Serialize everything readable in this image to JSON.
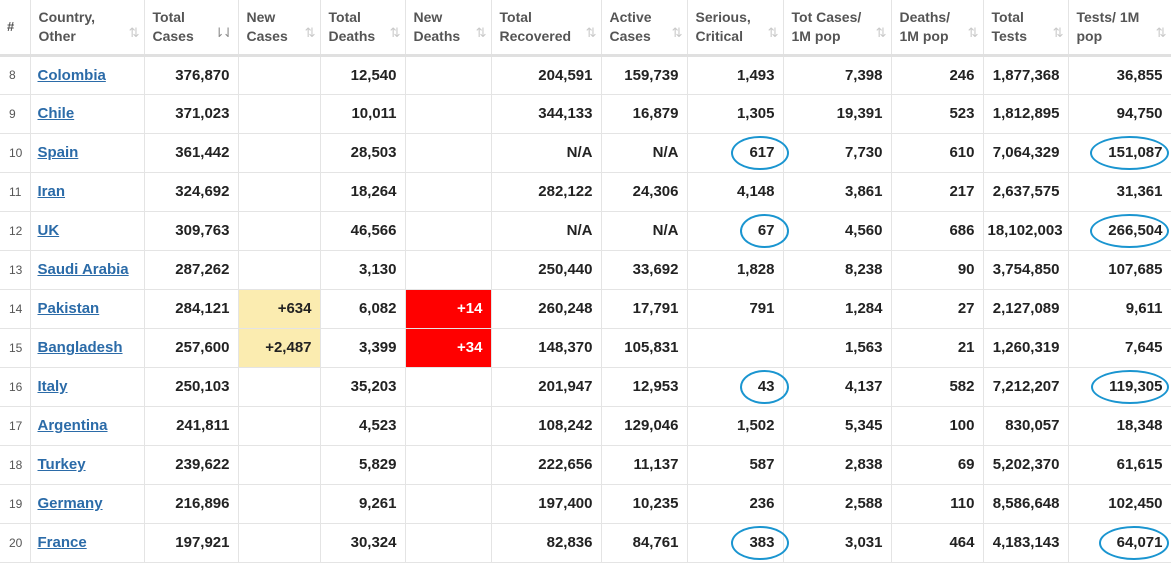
{
  "columns": [
    {
      "label": "#",
      "sortable": false
    },
    {
      "label": "Country, Other",
      "sortable": true
    },
    {
      "label": "Total Cases",
      "sortable": true,
      "active": true
    },
    {
      "label": "New Cases",
      "sortable": true
    },
    {
      "label": "Total Deaths",
      "sortable": true
    },
    {
      "label": "New Deaths",
      "sortable": true
    },
    {
      "label": "Total Recovered",
      "sortable": true
    },
    {
      "label": "Active Cases",
      "sortable": true
    },
    {
      "label": "Serious, Critical",
      "sortable": true
    },
    {
      "label": "Tot Cases/ 1M pop",
      "sortable": true
    },
    {
      "label": "Deaths/ 1M pop",
      "sortable": true
    },
    {
      "label": "Total Tests",
      "sortable": true
    },
    {
      "label": "Tests/ 1M pop",
      "sortable": true
    }
  ],
  "sort_icons": {
    "inactive": "⇅",
    "active": "⇂⇃"
  },
  "colors": {
    "new_cases_bg": "#fbecb0",
    "new_deaths_bg": "#ff0000",
    "link": "#2b6ba8",
    "circle_annotation": "#1a95d0"
  },
  "rows": [
    {
      "rank": "8",
      "country": "Colombia",
      "total_cases": "376,870",
      "new_cases": "",
      "total_deaths": "12,540",
      "new_deaths": "",
      "total_recovered": "204,591",
      "active_cases": "159,739",
      "serious": "1,493",
      "cases_per_m": "7,398",
      "deaths_per_m": "246",
      "total_tests": "1,877,368",
      "tests_per_m": "36,855"
    },
    {
      "rank": "9",
      "country": "Chile",
      "total_cases": "371,023",
      "new_cases": "",
      "total_deaths": "10,011",
      "new_deaths": "",
      "total_recovered": "344,133",
      "active_cases": "16,879",
      "serious": "1,305",
      "cases_per_m": "19,391",
      "deaths_per_m": "523",
      "total_tests": "1,812,895",
      "tests_per_m": "94,750"
    },
    {
      "rank": "10",
      "country": "Spain",
      "total_cases": "361,442",
      "new_cases": "",
      "total_deaths": "28,503",
      "new_deaths": "",
      "total_recovered": "N/A",
      "active_cases": "N/A",
      "serious": "617",
      "cases_per_m": "7,730",
      "deaths_per_m": "610",
      "total_tests": "7,064,329",
      "tests_per_m": "151,087",
      "circled": [
        "serious",
        "tests_per_m"
      ]
    },
    {
      "rank": "11",
      "country": "Iran",
      "total_cases": "324,692",
      "new_cases": "",
      "total_deaths": "18,264",
      "new_deaths": "",
      "total_recovered": "282,122",
      "active_cases": "24,306",
      "serious": "4,148",
      "cases_per_m": "3,861",
      "deaths_per_m": "217",
      "total_tests": "2,637,575",
      "tests_per_m": "31,361"
    },
    {
      "rank": "12",
      "country": "UK",
      "total_cases": "309,763",
      "new_cases": "",
      "total_deaths": "46,566",
      "new_deaths": "",
      "total_recovered": "N/A",
      "active_cases": "N/A",
      "serious": "67",
      "cases_per_m": "4,560",
      "deaths_per_m": "686",
      "total_tests": "18,102,003",
      "tests_per_m": "266,504",
      "circled": [
        "serious",
        "tests_per_m"
      ]
    },
    {
      "rank": "13",
      "country": "Saudi Arabia",
      "total_cases": "287,262",
      "new_cases": "",
      "total_deaths": "3,130",
      "new_deaths": "",
      "total_recovered": "250,440",
      "active_cases": "33,692",
      "serious": "1,828",
      "cases_per_m": "8,238",
      "deaths_per_m": "90",
      "total_tests": "3,754,850",
      "tests_per_m": "107,685"
    },
    {
      "rank": "14",
      "country": "Pakistan",
      "total_cases": "284,121",
      "new_cases": "+634",
      "total_deaths": "6,082",
      "new_deaths": "+14",
      "total_recovered": "260,248",
      "active_cases": "17,791",
      "serious": "791",
      "cases_per_m": "1,284",
      "deaths_per_m": "27",
      "total_tests": "2,127,089",
      "tests_per_m": "9,611"
    },
    {
      "rank": "15",
      "country": "Bangladesh",
      "total_cases": "257,600",
      "new_cases": "+2,487",
      "total_deaths": "3,399",
      "new_deaths": "+34",
      "total_recovered": "148,370",
      "active_cases": "105,831",
      "serious": "",
      "cases_per_m": "1,563",
      "deaths_per_m": "21",
      "total_tests": "1,260,319",
      "tests_per_m": "7,645"
    },
    {
      "rank": "16",
      "country": "Italy",
      "total_cases": "250,103",
      "new_cases": "",
      "total_deaths": "35,203",
      "new_deaths": "",
      "total_recovered": "201,947",
      "active_cases": "12,953",
      "serious": "43",
      "cases_per_m": "4,137",
      "deaths_per_m": "582",
      "total_tests": "7,212,207",
      "tests_per_m": "119,305",
      "circled": [
        "serious",
        "tests_per_m"
      ]
    },
    {
      "rank": "17",
      "country": "Argentina",
      "total_cases": "241,811",
      "new_cases": "",
      "total_deaths": "4,523",
      "new_deaths": "",
      "total_recovered": "108,242",
      "active_cases": "129,046",
      "serious": "1,502",
      "cases_per_m": "5,345",
      "deaths_per_m": "100",
      "total_tests": "830,057",
      "tests_per_m": "18,348"
    },
    {
      "rank": "18",
      "country": "Turkey",
      "total_cases": "239,622",
      "new_cases": "",
      "total_deaths": "5,829",
      "new_deaths": "",
      "total_recovered": "222,656",
      "active_cases": "11,137",
      "serious": "587",
      "cases_per_m": "2,838",
      "deaths_per_m": "69",
      "total_tests": "5,202,370",
      "tests_per_m": "61,615"
    },
    {
      "rank": "19",
      "country": "Germany",
      "total_cases": "216,896",
      "new_cases": "",
      "total_deaths": "9,261",
      "new_deaths": "",
      "total_recovered": "197,400",
      "active_cases": "10,235",
      "serious": "236",
      "cases_per_m": "2,588",
      "deaths_per_m": "110",
      "total_tests": "8,586,648",
      "tests_per_m": "102,450"
    },
    {
      "rank": "20",
      "country": "France",
      "total_cases": "197,921",
      "new_cases": "",
      "total_deaths": "30,324",
      "new_deaths": "",
      "total_recovered": "82,836",
      "active_cases": "84,761",
      "serious": "383",
      "cases_per_m": "3,031",
      "deaths_per_m": "464",
      "total_tests": "4,183,143",
      "tests_per_m": "64,071",
      "circled": [
        "serious",
        "tests_per_m"
      ]
    }
  ]
}
